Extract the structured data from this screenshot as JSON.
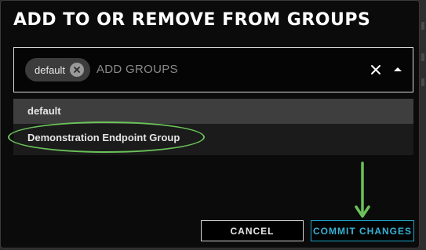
{
  "dialog": {
    "title": "ADD TO OR REMOVE FROM GROUPS"
  },
  "group_select": {
    "selected_chips": [
      {
        "label": "default"
      }
    ],
    "placeholder": "ADD GROUPS",
    "icons": {
      "chip_remove": "circle-x-icon",
      "clear": "close-icon",
      "toggle": "caret-up-icon"
    },
    "options": [
      {
        "label": "default",
        "highlighted": true
      },
      {
        "label": "Demonstration Endpoint Group",
        "highlighted": false
      }
    ]
  },
  "annotations": {
    "color": "#6ac259",
    "shapes": [
      "ellipse-around-option",
      "arrow-down-to-commit"
    ]
  },
  "footer": {
    "cancel_label": "CANCEL",
    "commit_label": "COMMIT CHANGES",
    "commit_color": "#37b3d6"
  }
}
